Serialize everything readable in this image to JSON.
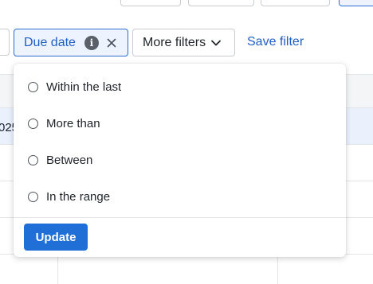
{
  "filter_bar": {
    "due_date_label": "Due date",
    "info_icon_glyph": "i",
    "more_filters_label": "More filters",
    "save_filter_label": "Save filter"
  },
  "table": {
    "partial_cell_text": "025"
  },
  "dropdown": {
    "options": [
      {
        "label": "Within the last",
        "selected": false
      },
      {
        "label": "More than",
        "selected": false
      },
      {
        "label": "Between",
        "selected": false
      },
      {
        "label": "In the range",
        "selected": false
      }
    ],
    "update_label": "Update"
  },
  "colors": {
    "accent": "#1f6fd6",
    "chip_active_bg": "#eef4ff",
    "selected_row_bg": "#eaf1fd"
  }
}
